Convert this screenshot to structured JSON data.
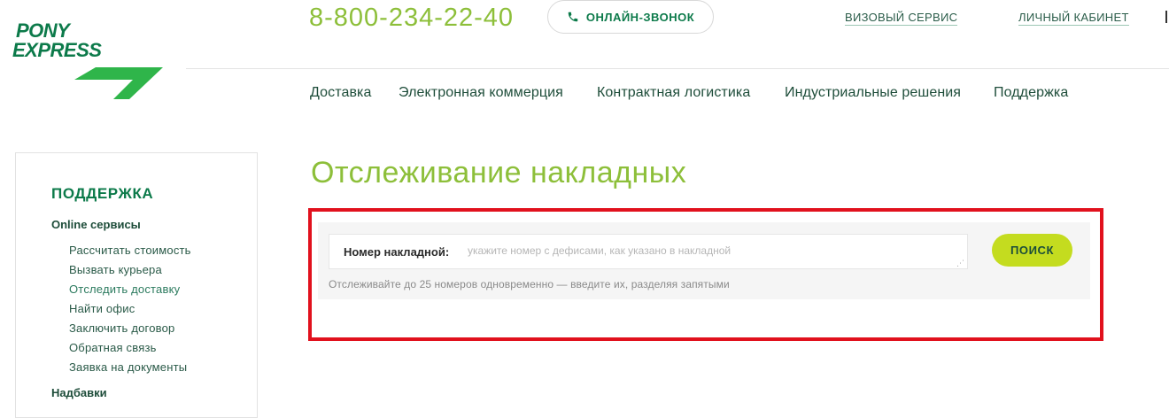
{
  "header": {
    "logo": {
      "line1": "PONY",
      "line2": "EXPRESS"
    },
    "phone": "8-800-234-22-40",
    "callback_label": "ОНЛАЙН-ЗВОНОК",
    "links": {
      "visa": "ВИЗОВЫЙ СЕРВИС",
      "cabinet": "ЛИЧНЫЙ КАБИНЕТ"
    }
  },
  "main_nav": [
    {
      "label": "Доставка"
    },
    {
      "label": "Электронная коммерция"
    },
    {
      "label": "Контрактная логистика"
    },
    {
      "label": "Индустриальные решения"
    },
    {
      "label": "Поддержка"
    }
  ],
  "sidebar": {
    "title": "ПОДДЕРЖКА",
    "sections": [
      {
        "label": "Online сервисы",
        "items": [
          "Рассчитать стоимость",
          "Вызвать курьера",
          "Отследить доставку",
          "Найти офис",
          "Заключить договор",
          "Обратная связь",
          "Заявка на документы"
        ]
      },
      {
        "label": "Надбавки"
      }
    ]
  },
  "main": {
    "title": "Отслеживание накладных",
    "tracking": {
      "field_label": "Номер накладной:",
      "placeholder": "укажите номер с дефисами, как указано в накладной",
      "value": "",
      "button_label": "ПОИСК",
      "hint": "Отслеживайте до 25 номеров одновременно — введите их, разделяя запятыми"
    }
  },
  "colors": {
    "brand_green": "#0c7a4a",
    "accent_lime": "#8dbf3a",
    "button_lime": "#c4dc1f",
    "highlight_red": "#e1111d"
  }
}
